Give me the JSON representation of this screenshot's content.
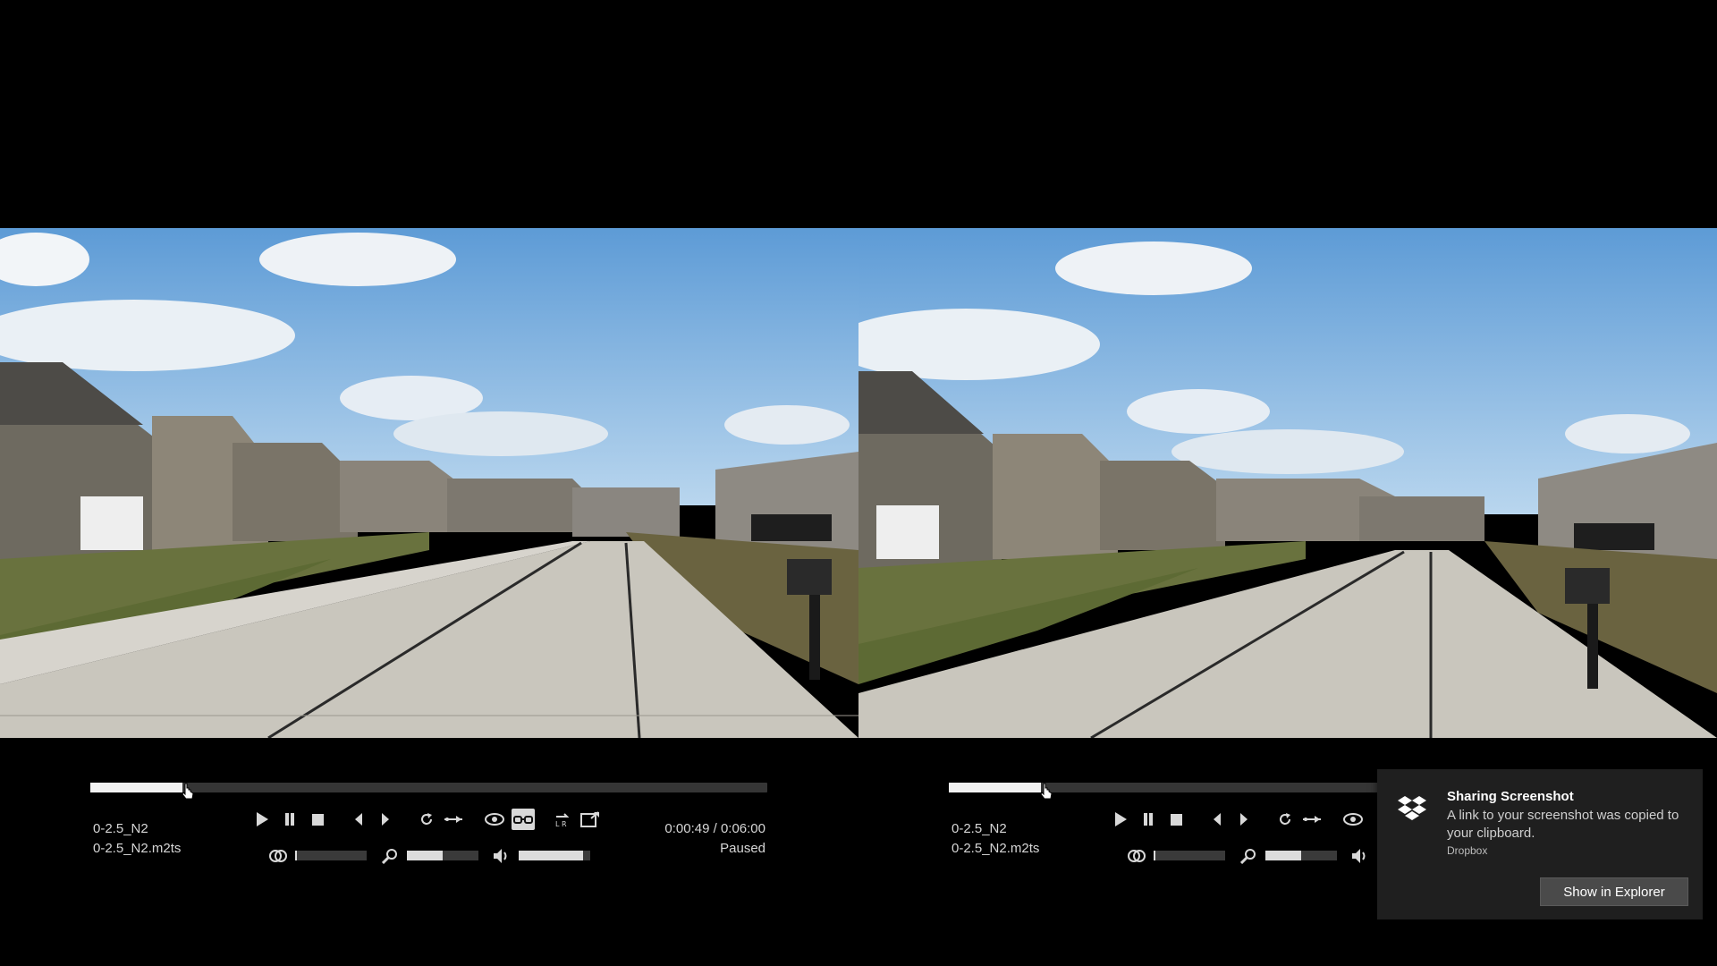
{
  "left_player": {
    "file_title": "0-2.5_N2",
    "file_name": "0-2.5_N2.m2ts",
    "time": "0:00:49 / 0:06:00",
    "status": "Paused",
    "progress": 0.136,
    "opacity_level": 0.02,
    "zoom_level": 0.5,
    "volume_level": 0.9
  },
  "right_player": {
    "file_title": "0-2.5_N2",
    "file_name": "0-2.5_N2.m2ts",
    "progress": 0.136,
    "opacity_level": 0.02,
    "zoom_level": 0.5
  },
  "notification": {
    "title": "Sharing Screenshot",
    "message": "A link to your screenshot was copied to your clipboard.",
    "app": "Dropbox",
    "action_label": "Show in Explorer"
  },
  "icons": [
    "play-icon",
    "pause-icon",
    "stop-icon",
    "previous-icon",
    "next-icon",
    "loop-icon",
    "ab-repeat-icon",
    "eye-icon",
    "stereo-glasses-icon",
    "swap-lr-icon",
    "output-icon",
    "opacity-icon",
    "zoom-icon",
    "volume-icon",
    "dropbox-icon"
  ],
  "colors": {
    "sky": "#7fb3df",
    "road": "#c9c6bd",
    "grass": "#6f7a3a",
    "seek_fill": "#f2f2f2",
    "toast_bg": "#1f1f1f"
  }
}
